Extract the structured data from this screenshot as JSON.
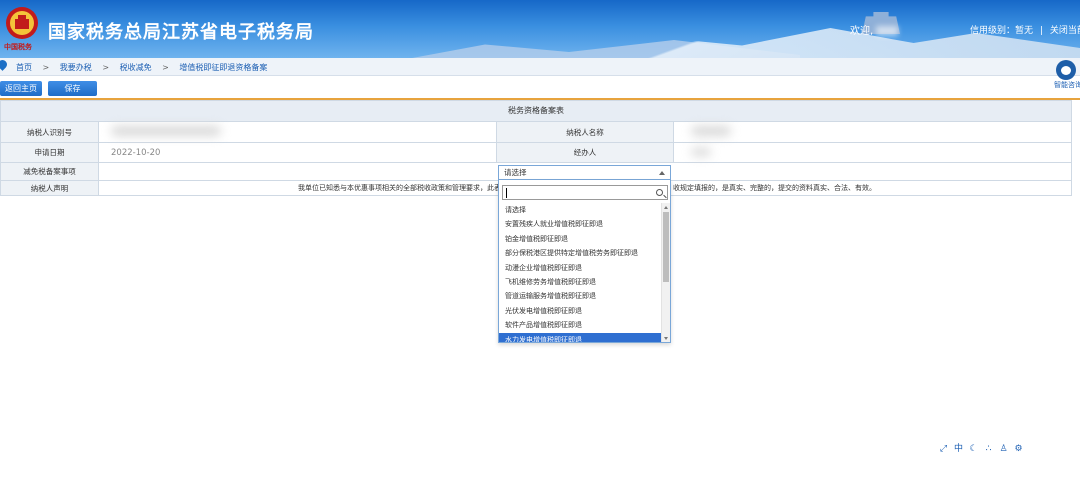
{
  "header": {
    "title": "国家税务总局江苏省电子税务局",
    "emblem_text": "中国税务",
    "welcome": "欢迎,",
    "credit_level": "信用级别：暂无",
    "separator": "|",
    "close": "关闭当前"
  },
  "breadcrumb": [
    "首页",
    "我要办税",
    "税收减免",
    "增值税即征即退资格备案"
  ],
  "breadcrumb_sep": ">",
  "assistant": {
    "label": "智能咨询"
  },
  "toolbar": {
    "home_label": "返回主页",
    "save_label": "保存"
  },
  "form": {
    "title": "税务资格备案表",
    "rows": {
      "taxpayer_id_label": "纳税人识别号",
      "taxpayer_name_label": "纳税人名称",
      "apply_date_label": "申请日期",
      "apply_date_value": "2022-10-20",
      "handler_label": "经办人",
      "reduction_item_label": "减免税备案事项",
      "declaration_label": "纳税人声明",
      "declaration_part1": "我单位已知悉与本优惠事项相关的全部税收政策和管理要求，此表",
      "declaration_part2": "收规定填报的，是真实、完整的，提交的资料真实、合法、有效。"
    },
    "select": {
      "value": "请选择",
      "options": [
        "请选择",
        "安置残疾人就业增值税即征即退",
        "铂金增值税即征即退",
        "部分保税港区提供特定增值税劳务即征即退",
        "动漫企业增值税即征即退",
        "飞机维修劳务增值税即征即退",
        "管道运输服务增值税即征即退",
        "光伏发电增值税即征即退",
        "软件产品增值税即征即退",
        "水力发电增值税即征即退"
      ],
      "highlighted_index": 9
    }
  },
  "tools": [
    "expand-icon",
    "中",
    "moon-icon",
    "dots-icon",
    "person-icon",
    "gear-icon"
  ],
  "colors": {
    "primary": "#1f6cc7",
    "accent_line": "#e7a33d",
    "highlight": "#2f6fd1"
  }
}
